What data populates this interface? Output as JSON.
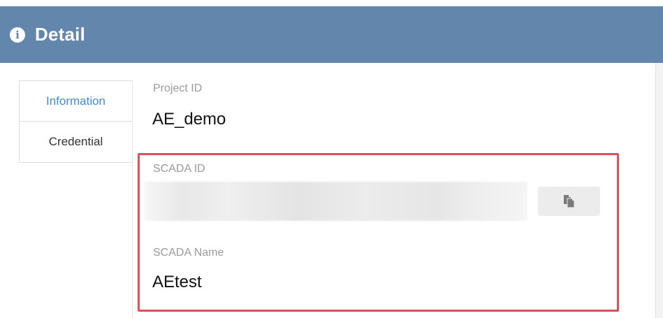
{
  "header": {
    "title": "Detail",
    "icon": "info-icon",
    "background_color": "#6386ac"
  },
  "tabs": [
    {
      "label": "Information",
      "active": true
    },
    {
      "label": "Credential",
      "active": false
    }
  ],
  "fields": {
    "project_id": {
      "label": "Project ID",
      "value": "AE_demo"
    },
    "scada_id": {
      "label": "SCADA ID",
      "value_obscured": true,
      "copy_icon": "copy-icon"
    },
    "scada_name": {
      "label": "SCADA Name",
      "value": "AEtest"
    }
  },
  "colors": {
    "accent_tab": "#3d8ed6",
    "highlight_border": "#e0505b"
  }
}
